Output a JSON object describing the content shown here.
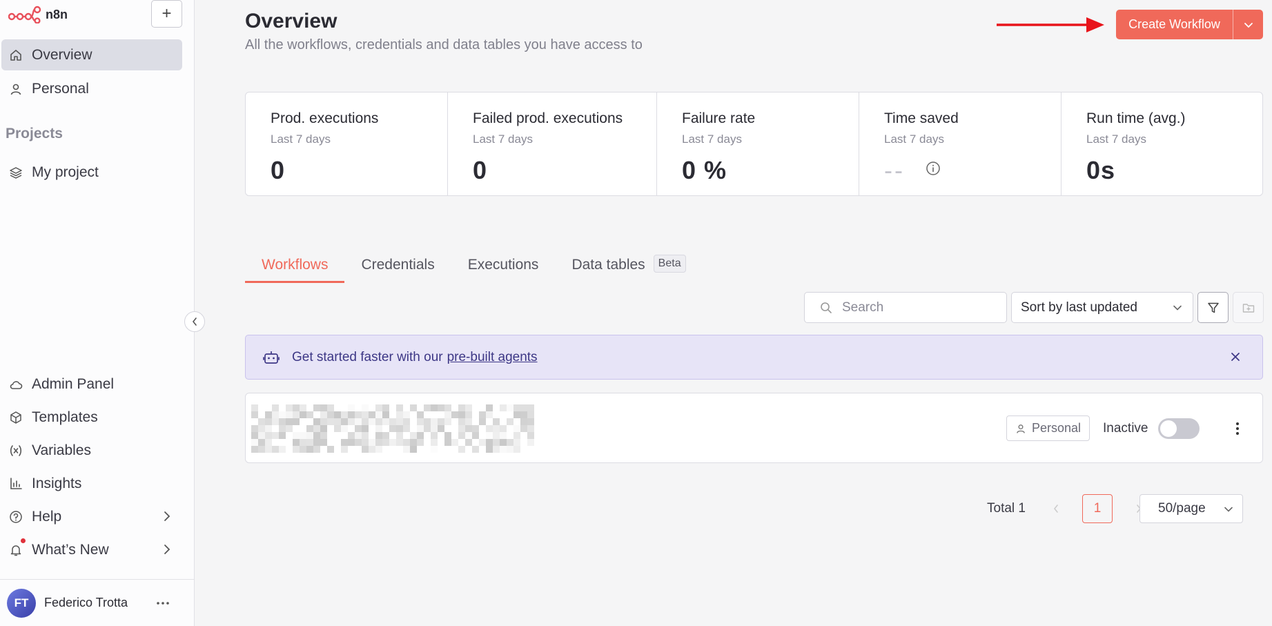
{
  "app": {
    "name": "n8n"
  },
  "sidebar": {
    "add_label": "+",
    "nav": [
      {
        "label": "Overview",
        "icon": "home-icon",
        "active": true
      },
      {
        "label": "Personal",
        "icon": "user-icon",
        "active": false
      }
    ],
    "projects_heading": "Projects",
    "projects": [
      {
        "label": "My project",
        "icon": "layers-icon"
      }
    ],
    "bottom": [
      {
        "label": "Admin Panel",
        "icon": "cloud-icon"
      },
      {
        "label": "Templates",
        "icon": "box-icon"
      },
      {
        "label": "Variables",
        "icon": "variable-icon"
      },
      {
        "label": "Insights",
        "icon": "bar-chart-icon"
      },
      {
        "label": "Help",
        "icon": "help-icon"
      },
      {
        "label": "What’s New",
        "icon": "bell-icon"
      }
    ],
    "user": {
      "initials": "FT",
      "name": "Federico Trotta"
    }
  },
  "header": {
    "title": "Overview",
    "subtitle": "All the workflows, credentials and data tables you have access to",
    "create_button": "Create Workflow"
  },
  "stats": [
    {
      "label": "Prod. executions",
      "period": "Last 7 days",
      "value": "0"
    },
    {
      "label": "Failed prod. executions",
      "period": "Last 7 days",
      "value": "0"
    },
    {
      "label": "Failure rate",
      "period": "Last 7 days",
      "value": "0 %"
    },
    {
      "label": "Time saved",
      "period": "Last 7 days",
      "value": "--"
    },
    {
      "label": "Run time (avg.)",
      "period": "Last 7 days",
      "value": "0s"
    }
  ],
  "tabs": [
    {
      "label": "Workflows",
      "active": true
    },
    {
      "label": "Credentials",
      "active": false
    },
    {
      "label": "Executions",
      "active": false
    },
    {
      "label": "Data tables",
      "active": false,
      "badge": "Beta"
    }
  ],
  "toolbar": {
    "search_placeholder": "Search",
    "sort_value": "Sort by last updated"
  },
  "banner": {
    "text": "Get started faster with our",
    "link": "pre-built agents"
  },
  "workflows": [
    {
      "project": "Personal",
      "status": "Inactive",
      "active": false
    }
  ],
  "pagination": {
    "total": "Total 1",
    "current_page": "1",
    "per_page": "50/page"
  },
  "colors": {
    "accent": "#f0695a",
    "banner_bg": "#e7e4f7",
    "banner_text": "#3d3786",
    "arrow": "#e8141b",
    "notification": "#e0323c"
  }
}
